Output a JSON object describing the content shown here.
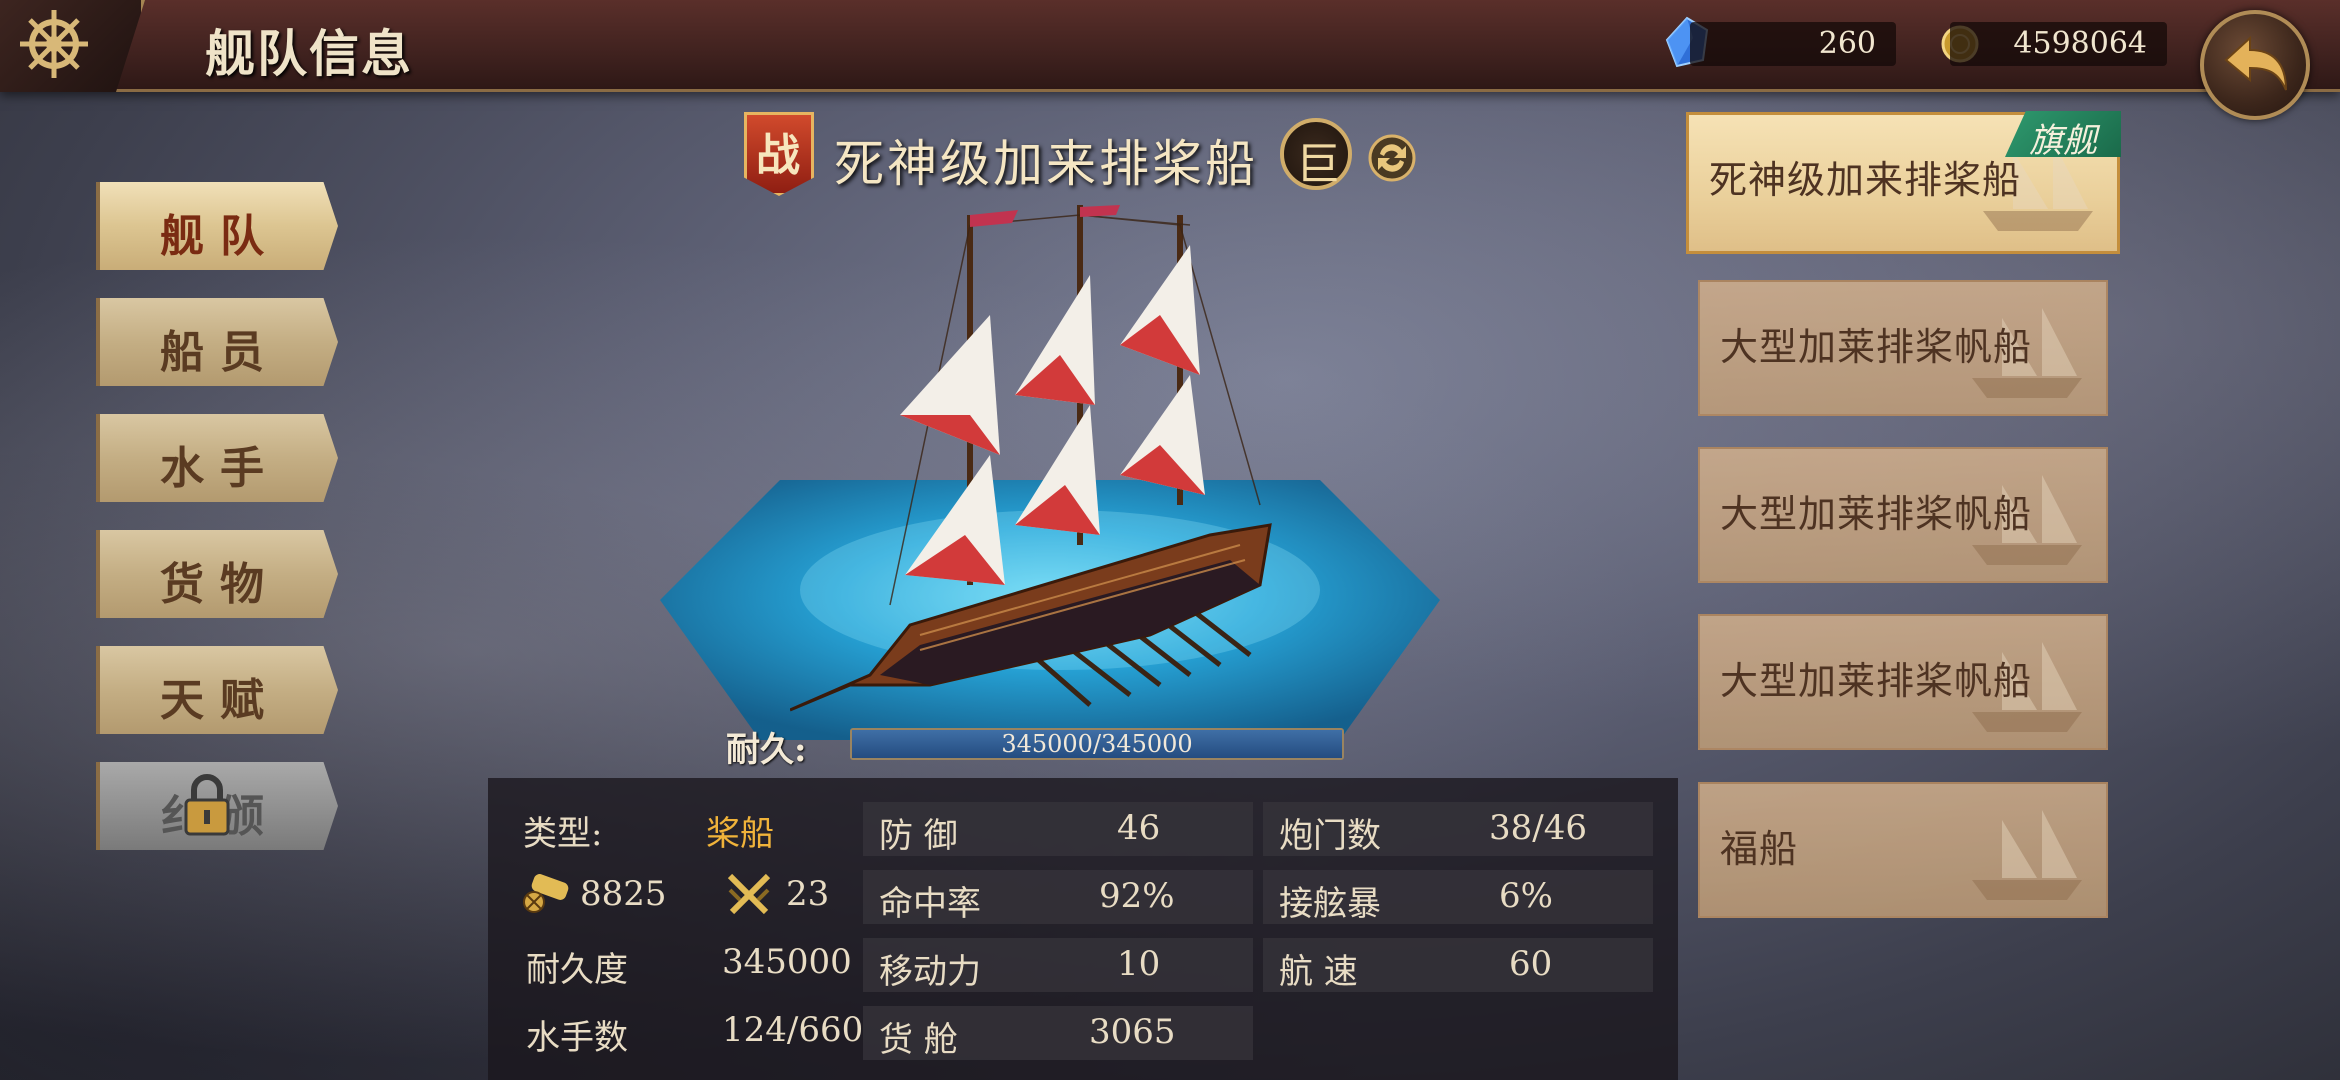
{
  "header": {
    "title": "舰队信息",
    "gems": "260",
    "gold": "4598064"
  },
  "nav": {
    "items": [
      {
        "label": "舰队",
        "active": true
      },
      {
        "label": "船员"
      },
      {
        "label": "水手"
      },
      {
        "label": "货物"
      },
      {
        "label": "天赋"
      },
      {
        "label": "纟颁",
        "locked": true
      }
    ]
  },
  "ship": {
    "badge": "战",
    "name": "死神级加来排桨船",
    "size": "巨",
    "durability_label": "耐久:",
    "durability_text": "345000/345000",
    "durability_fraction": 1.0
  },
  "stats": {
    "type_label": "类型:",
    "type_value": "桨船",
    "cannon_value": "8825",
    "melee_value": "23",
    "durability_label": "耐久度",
    "durability_value": "345000",
    "sailors_label": "水手数",
    "sailors_value": "124/660",
    "defense_label": "防 御",
    "defense_value": "46",
    "hit_label": "命中率",
    "hit_value": "92%",
    "move_label": "移动力",
    "move_value": "10",
    "cargo_label": "货 舱",
    "cargo_value": "3065",
    "gunports_label": "炮门数",
    "gunports_value": "38/46",
    "boarding_label": "接舷暴",
    "boarding_value": "6%",
    "speed_label": "航 速",
    "speed_value": "60"
  },
  "fleet": {
    "flagship_tag": "旗舰",
    "ships": [
      {
        "name": "死神级加来排桨船",
        "active": true
      },
      {
        "name": "大型加莱排桨帆船"
      },
      {
        "name": "大型加莱排桨帆船"
      },
      {
        "name": "大型加莱排桨帆船"
      },
      {
        "name": "福船"
      }
    ]
  },
  "colors": {
    "accent_gold": "#f0b33a",
    "durability_fill": "#2f5f98",
    "flag_tag": "#2f9a6f"
  }
}
